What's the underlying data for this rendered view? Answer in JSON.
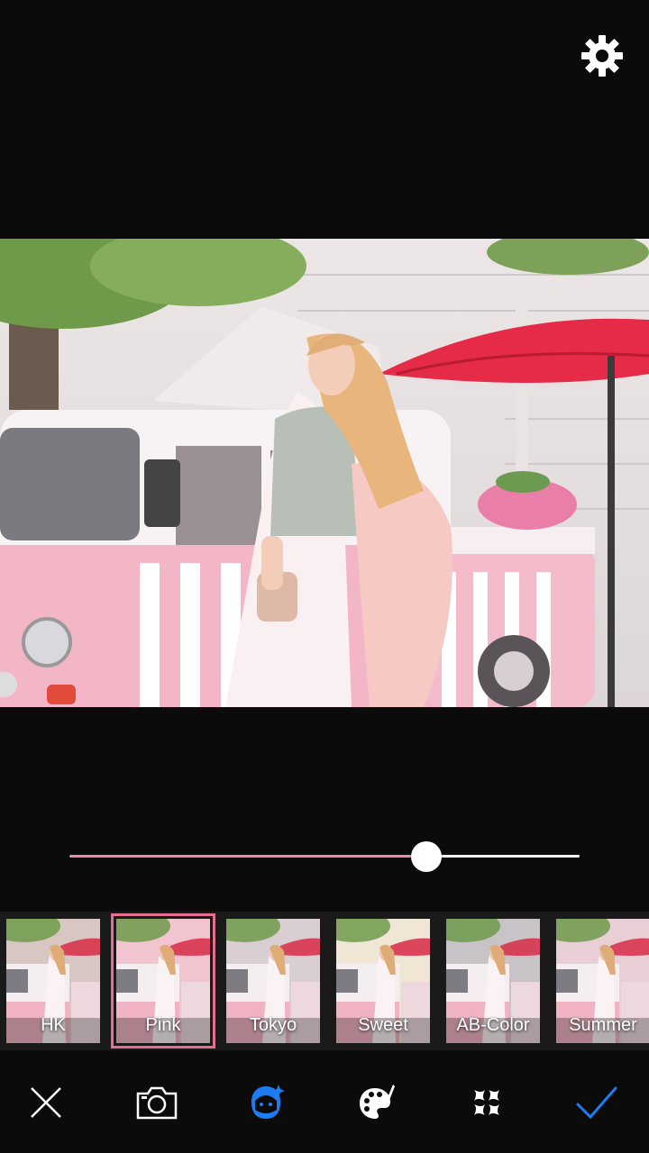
{
  "slider": {
    "value": 0.7
  },
  "filters": [
    {
      "name": "HK",
      "selected": false,
      "tone": "#d8c6c2"
    },
    {
      "name": "Pink",
      "selected": true,
      "tone": "#f2c4cf"
    },
    {
      "name": "Tokyo",
      "selected": false,
      "tone": "#d9cfd2"
    },
    {
      "name": "Sweet",
      "selected": false,
      "tone": "#efe6d5"
    },
    {
      "name": "AB-Color",
      "selected": false,
      "tone": "#c8c3c6"
    },
    {
      "name": "Summer",
      "selected": false,
      "tone": "#e8cfd6"
    }
  ],
  "toolbar": {
    "items": [
      {
        "icon": "close-icon",
        "active": false
      },
      {
        "icon": "camera-icon",
        "active": false
      },
      {
        "icon": "face-beauty-icon",
        "active": true
      },
      {
        "icon": "palette-brush-icon",
        "active": false
      },
      {
        "icon": "grid-tiles-icon",
        "active": false
      },
      {
        "icon": "checkmark-icon",
        "active": false
      }
    ]
  },
  "colors": {
    "background": "#0b0b0c",
    "accent_pink": "#e4708f",
    "accent_blue": "#1e7cf0",
    "strip_background": "#1a1a1a"
  }
}
